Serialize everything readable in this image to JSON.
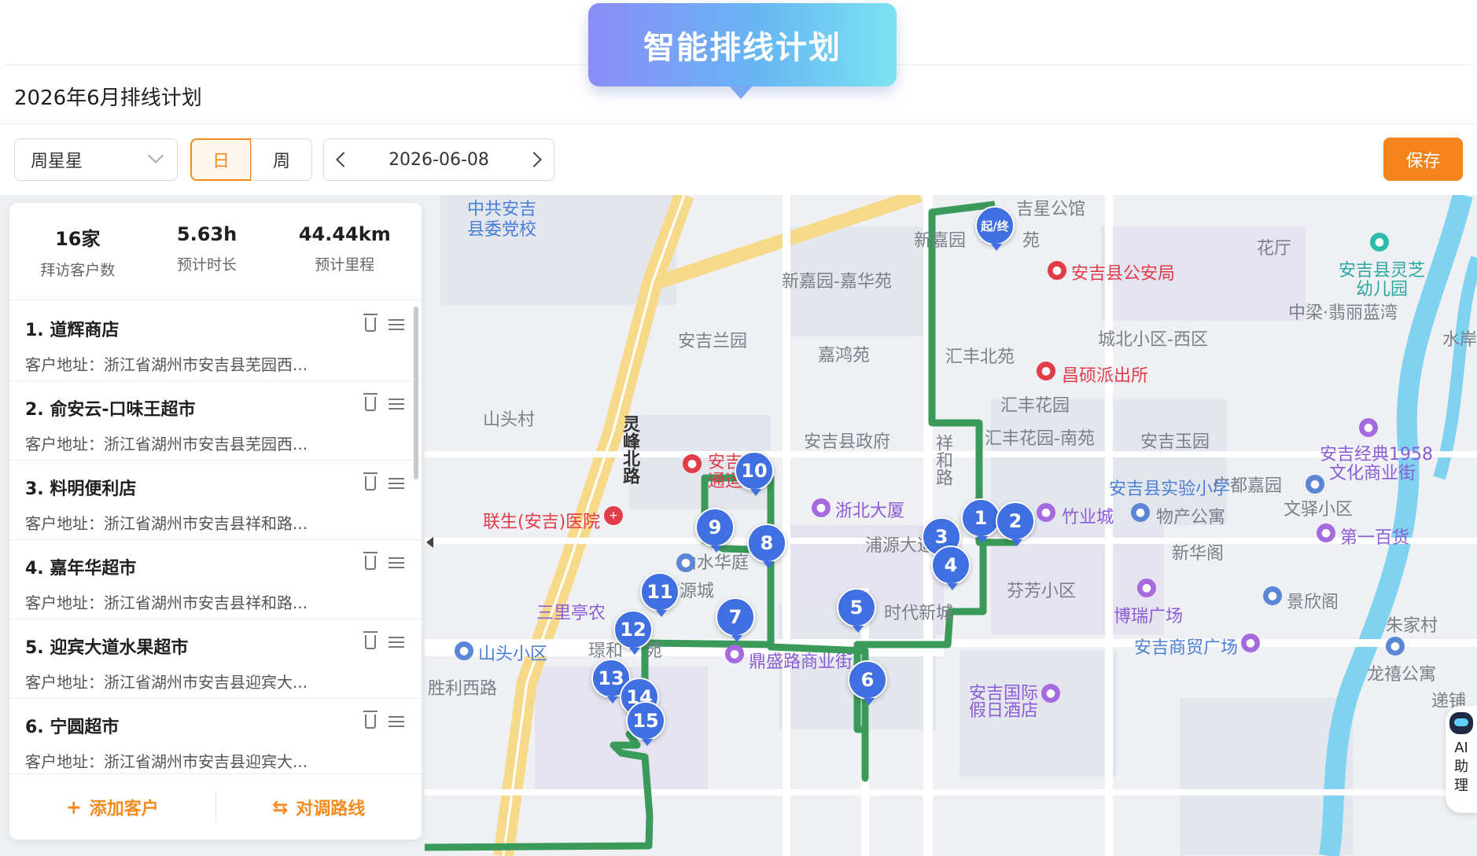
{
  "banner": {
    "title": "智能排线计划"
  },
  "plan": {
    "title": "2026年6月排线计划"
  },
  "toolbar": {
    "person": "周星星",
    "day_label": "日",
    "week_label": "周",
    "date": "2026-06-08",
    "save_label": "保存"
  },
  "stats": [
    {
      "value": "16家",
      "label": "拜访客户数"
    },
    {
      "value": "5.63h",
      "label": "预计时长"
    },
    {
      "value": "44.44km",
      "label": "预计里程"
    }
  ],
  "customers": [
    {
      "name": "1. 道辉商店",
      "address": "客户地址：浙江省湖州市安吉县芜园西..."
    },
    {
      "name": "2. 俞安云-口味王超市",
      "address": "客户地址：浙江省湖州市安吉县芜园西..."
    },
    {
      "name": "3. 料明便利店",
      "address": "客户地址：浙江省湖州市安吉县祥和路..."
    },
    {
      "name": "4. 嘉年华超市",
      "address": "客户地址：浙江省湖州市安吉县祥和路..."
    },
    {
      "name": "5. 迎宾大道水果超市",
      "address": "客户地址：浙江省湖州市安吉县迎宾大..."
    },
    {
      "name": "6. 宁圆超市",
      "address": "客户地址：浙江省湖州市安吉县迎宾大..."
    }
  ],
  "footer": {
    "add_label": "添加客户",
    "adjust_label": "对调路线"
  },
  "ai": {
    "label": "AI助理"
  },
  "map": {
    "route_color": "#3a9a5a",
    "marker_color": "#3f6fe0",
    "start_label": "起/终",
    "markers": [
      "1",
      "2",
      "3",
      "4",
      "5",
      "6",
      "7",
      "8",
      "9",
      "10",
      "11",
      "12",
      "13",
      "14",
      "15"
    ],
    "labels": {
      "l1": "中共安吉",
      "l2": "县委党校",
      "l3": "吉星公馆",
      "l4": "新嘉园",
      "l5": "苑",
      "l6": "花厅",
      "l7": "安吉县公安局",
      "l8": "安吉县灵芝",
      "l9": "幼儿园",
      "l10": "新嘉园-嘉华苑",
      "l11": "中梁·翡丽蓝湾",
      "l12": "安吉兰园",
      "l13": "嘉鸿苑",
      "l14": "汇丰北苑",
      "l15": "城北小区-西区",
      "l16": "水岸",
      "l17": "昌硕派出所",
      "l18": "灵峰北路",
      "l19": "山头村",
      "l20": "汇丰花园",
      "l21": "祥和路",
      "l22": "安吉县政府",
      "l23": "汇丰花园-南苑",
      "l24": "安吉玉园",
      "l25": "安吉经典1958",
      "l26": "文化商业街",
      "l27": "安吉",
      "l28": "通运",
      "l29": "山头小区",
      "l30": "广都嘉园",
      "l31": "山水华庭",
      "l32": "安吉县实验小学",
      "l33": "文驿小区",
      "l34": "浙北大厦",
      "l35": "竹业城",
      "l36": "物产公寓",
      "l37": "联生(安吉)医院",
      "l38": "第一百货",
      "l39": "浦源大道",
      "l40": "新华阁",
      "l41": "浦源城",
      "l42": "芬芳小区",
      "l43": "时代新城",
      "l44": "三里亭农",
      "l45": "博瑞广场",
      "l46": "景欣阁",
      "l47": "朱家村",
      "l48": "安吉商贸广场",
      "l49": "璟和",
      "l50": "苑",
      "l51": "鼎盛路商业街",
      "l52": "龙禧公寓",
      "l53": "胜利西路",
      "l54": "安吉国际",
      "l55": "假日酒店",
      "l56": "递铺"
    }
  }
}
